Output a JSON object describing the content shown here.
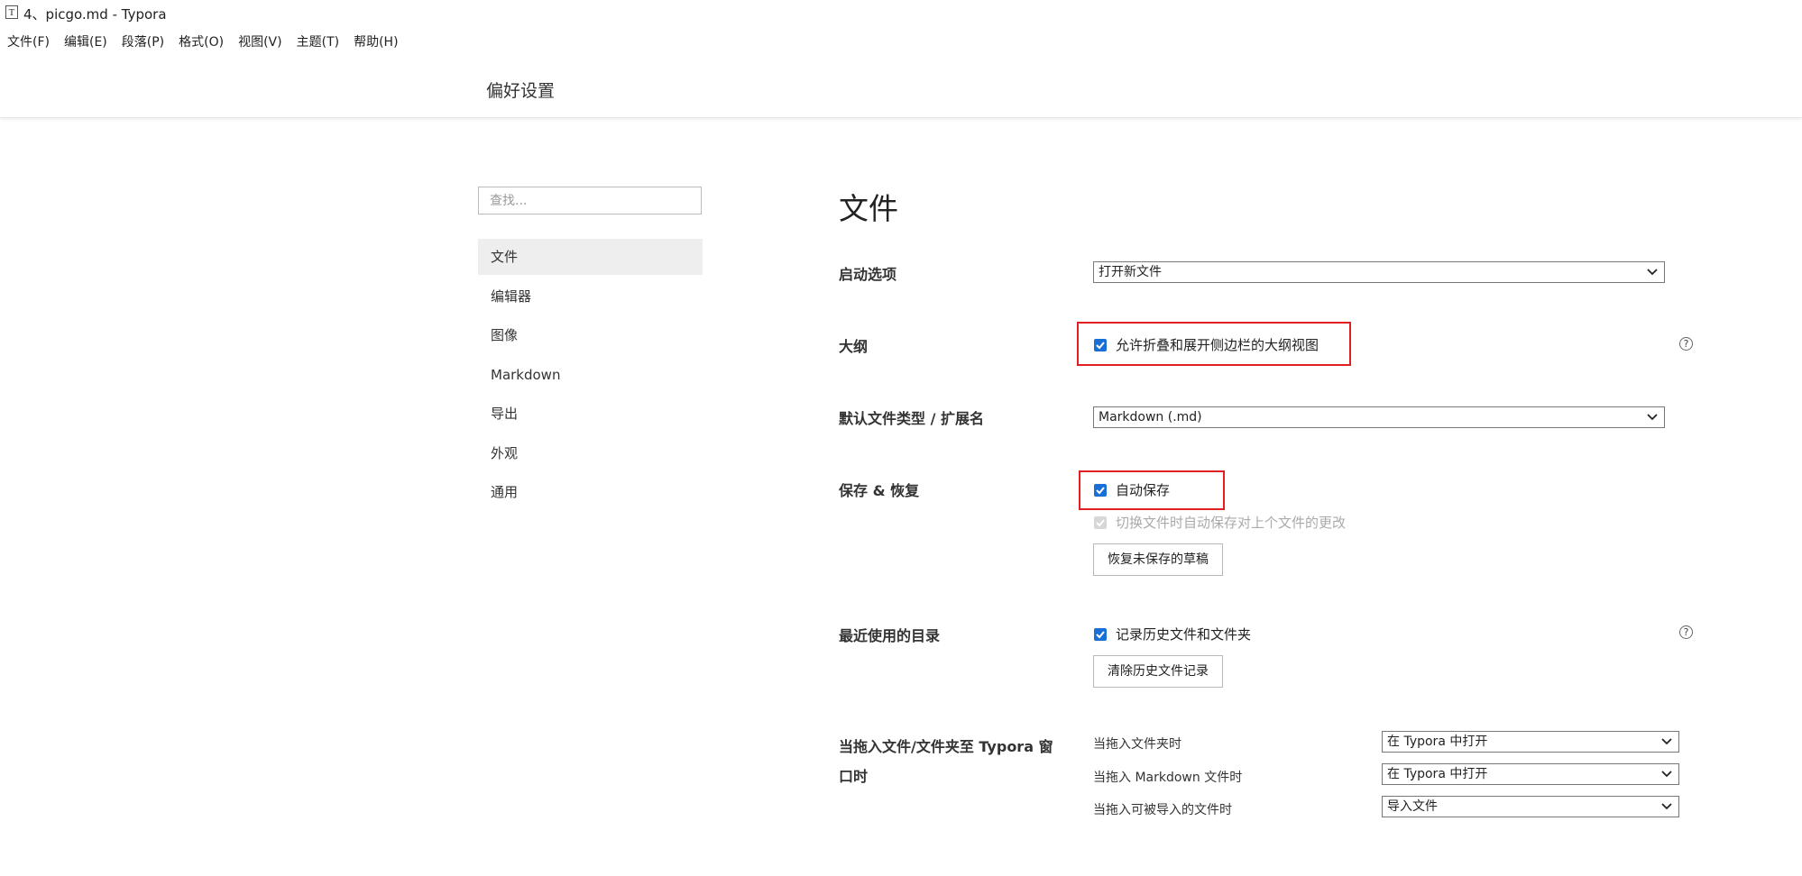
{
  "window": {
    "app_icon_letter": "T",
    "title": "4、picgo.md - Typora"
  },
  "menu": [
    {
      "label": "文件(F)"
    },
    {
      "label": "编辑(E)"
    },
    {
      "label": "段落(P)"
    },
    {
      "label": "格式(O)"
    },
    {
      "label": "视图(V)"
    },
    {
      "label": "主题(T)"
    },
    {
      "label": "帮助(H)"
    }
  ],
  "prefs": {
    "title": "偏好设置",
    "search_placeholder": "查找...",
    "nav": [
      {
        "label": "文件",
        "active": true
      },
      {
        "label": "编辑器"
      },
      {
        "label": "图像"
      },
      {
        "label": "Markdown"
      },
      {
        "label": "导出"
      },
      {
        "label": "外观"
      },
      {
        "label": "通用"
      }
    ]
  },
  "section": {
    "title": "文件",
    "startup": {
      "label": "启动选项",
      "value": "打开新文件"
    },
    "outline": {
      "label": "大纲",
      "checkbox_label": "允许折叠和展开侧边栏的大纲视图",
      "checked": true,
      "help": "?"
    },
    "default_type": {
      "label": "默认文件类型 / 扩展名",
      "value": "Markdown (.md)"
    },
    "save": {
      "label": "保存 & 恢复",
      "autosave_label": "自动保存",
      "autosave_checked": true,
      "switch_label": "切换文件时自动保存对上个文件的更改",
      "switch_checked": true,
      "switch_disabled": true,
      "restore_button": "恢复未保存的草稿"
    },
    "recent": {
      "label": "最近使用的目录",
      "checkbox_label": "记录历史文件和文件夹",
      "checked": true,
      "clear_button": "清除历史文件记录",
      "help": "?"
    },
    "drag": {
      "label_line1": "当拖入文件/文件夹至 Typora 窗",
      "label_line2": "口时",
      "rows": [
        {
          "label": "当拖入文件夹时",
          "value": "在 Typora 中打开"
        },
        {
          "label": "当拖入 Markdown 文件时",
          "value": "在 Typora 中打开"
        },
        {
          "label": "当拖入可被导入的文件时",
          "value": "导入文件"
        }
      ]
    }
  },
  "colors": {
    "accent": "#1a6fd6",
    "highlight_border": "#e02020",
    "nav_active_bg": "#eeeeee"
  }
}
